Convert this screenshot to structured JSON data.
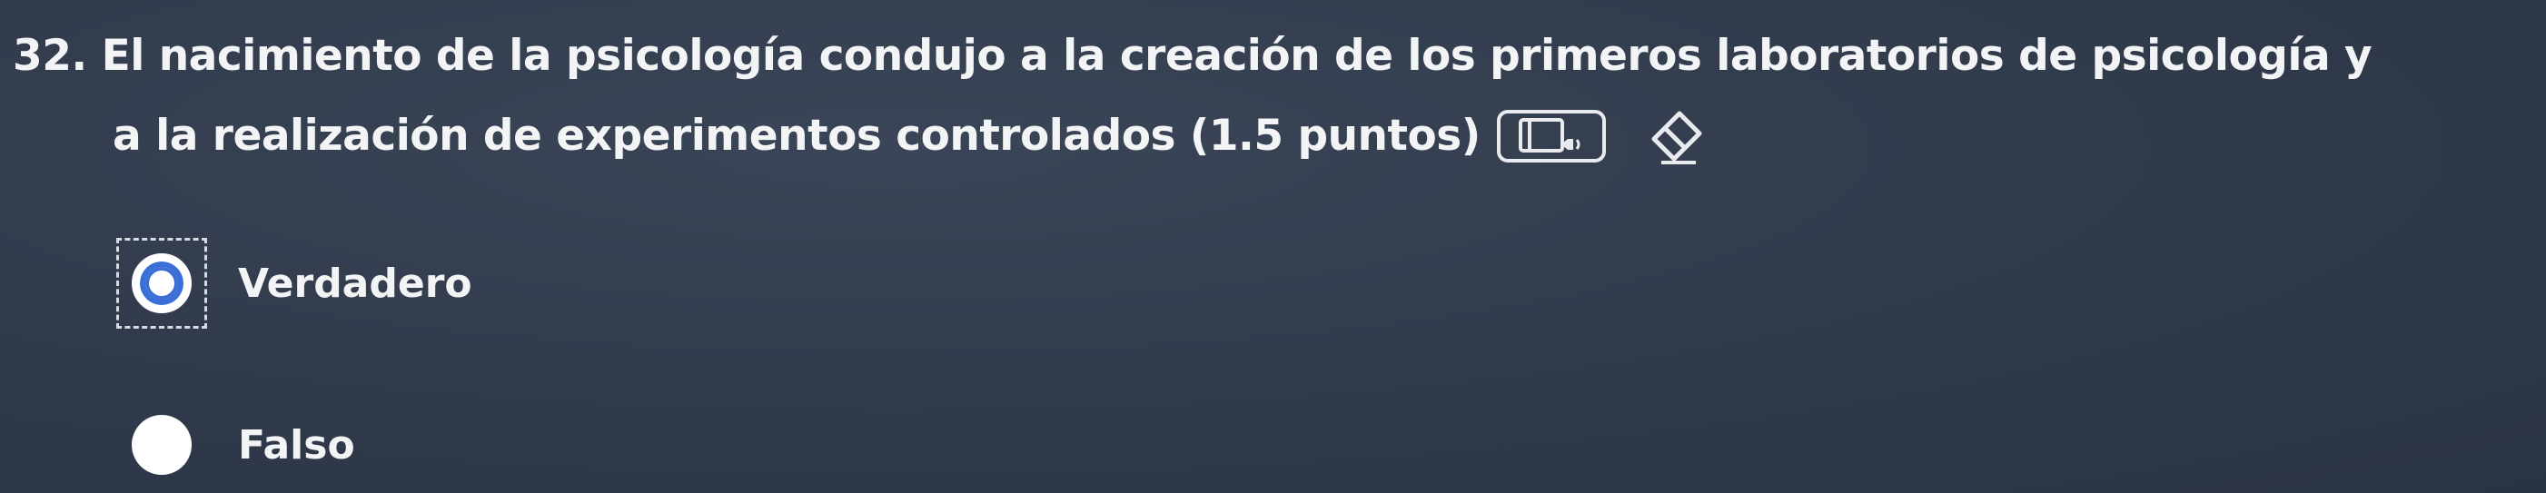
{
  "question": {
    "line1": "32. El nacimiento de la psicología condujo a la creación de los primeros laboratorios de psicología y",
    "line2": "a la realización de experimentos controlados (1.5 puntos)",
    "audio_icon": "audio-read-aloud-icon",
    "eraser_icon": "eraser-icon"
  },
  "options": [
    {
      "label": "Verdadero",
      "selected": true
    },
    {
      "label": "Falso",
      "selected": false
    }
  ],
  "colors": {
    "background": "#323c4d",
    "text": "#f3f4f6",
    "accent": "#3a6fd8"
  }
}
